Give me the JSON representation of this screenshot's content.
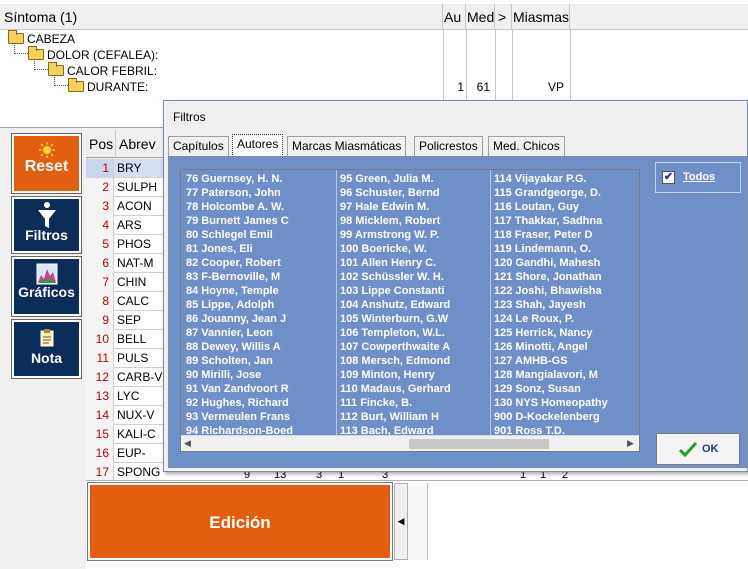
{
  "symptom_header": {
    "title": "Síntoma (1)",
    "col_au": "Au",
    "col_med": "Med",
    "col_gt": ">",
    "col_miasmas": "Miasmas"
  },
  "tree": {
    "nodes": [
      "CABEZA",
      "DOLOR (CEFALEA):",
      "CALOR FEBRIL:",
      "DURANTE:"
    ],
    "au_value": "1",
    "med_value": "61",
    "miasma_value": "VP"
  },
  "left_buttons": {
    "reset": "Reset",
    "filtros": "Filtros",
    "graficos": "Gráficos",
    "nota": "Nota"
  },
  "grid": {
    "col_pos": "Pos",
    "col_abrev": "Abrev",
    "rows": [
      {
        "n": "1",
        "a": "BRY"
      },
      {
        "n": "2",
        "a": "SULPH"
      },
      {
        "n": "3",
        "a": "ACON"
      },
      {
        "n": "4",
        "a": "ARS"
      },
      {
        "n": "5",
        "a": "PHOS"
      },
      {
        "n": "6",
        "a": "NAT-M"
      },
      {
        "n": "7",
        "a": "CHIN"
      },
      {
        "n": "8",
        "a": "CALC"
      },
      {
        "n": "9",
        "a": "SEP"
      },
      {
        "n": "10",
        "a": "BELL"
      },
      {
        "n": "11",
        "a": "PULS"
      },
      {
        "n": "12",
        "a": "CARB-V"
      },
      {
        "n": "13",
        "a": "LYC"
      },
      {
        "n": "14",
        "a": "NUX-V"
      },
      {
        "n": "15",
        "a": "KALI-C"
      },
      {
        "n": "16",
        "a": "EUP-PER"
      },
      {
        "n": "17",
        "a": "SPONG"
      }
    ],
    "bottom_numbers": [
      "9",
      "13",
      "3",
      "1",
      "3",
      "1",
      "1",
      "2"
    ]
  },
  "dialog": {
    "title": "Filtros",
    "tabs": [
      "Capítulos",
      "Autores",
      "Marcas Miasmáticas",
      "Policrestos",
      "Med. Chicos"
    ],
    "active_tab": "Autores",
    "todos_label": "Todos",
    "todos_checked": true,
    "ok_label": "OK",
    "authors_col1": [
      "76 Guernsey, H. N.",
      "77 Paterson, John",
      "78 Holcombe A. W.",
      "79 Burnett James C",
      "80 Schlegel Emil",
      "81 Jones, Eli",
      "82 Cooper, Robert",
      "83 F-Bernoville, M",
      "84 Hoyne, Temple",
      "85 Lippe, Adolph",
      "86 Jouanny, Jean J",
      "87 Vannier, Leon",
      "88 Dewey, Willis A",
      "89 Scholten, Jan",
      "90 Mirilli, Jose",
      "91 Van Zandvoort R",
      "92 Hughes, Richard",
      "93 Vermeulen Frans",
      "94 Richardson-Boed"
    ],
    "authors_col2": [
      "95 Green, Julia M.",
      "96 Schuster, Bernd",
      "97 Hale Edwin M.",
      "98 Micklem, Robert",
      "99 Armstrong W. P.",
      "100 Boericke, W.",
      "101 Allen Henry C.",
      "102 Schüssler W. H.",
      "103 Lippe Constanti",
      "104 Anshutz, Edward",
      "105 Winterburn, G.W",
      "106 Templeton, W.L.",
      "107 Cowperthwaite A",
      "108 Mersch, Edmond",
      "109 Minton, Henry",
      "110 Madaus, Gerhard",
      "111 Fincke, B.",
      "112 Burt, William H",
      "113 Bach, Edward"
    ],
    "authors_col3": [
      "114 Vijayakar P.G.",
      "115 Grandgeorge, D.",
      "116 Loutan, Guy",
      "117 Thakkar, Sadhna",
      "118 Fraser, Peter D",
      "119 Lindemann, O.",
      "120 Gandhi, Mahesh",
      "121 Shore, Jonathan",
      "122 Joshi, Bhawisha",
      "123 Shah, Jayesh",
      "124 Le Roux, P.",
      "125 Herrick, Nancy",
      "126 Minotti, Angel",
      "127 AMHB-GS",
      "128 Mangialavori, M",
      "129 Sonz, Susan",
      "130 NYS Homeopathy",
      "900 D-Kockelenberg",
      "901 Ross T.D."
    ]
  },
  "bottom": {
    "edicion": "Edición"
  },
  "colors": {
    "orange": "#e35f0f",
    "navy": "#0b2d5a",
    "list_blue": "#6e90c8",
    "red_text": "#c00000"
  }
}
